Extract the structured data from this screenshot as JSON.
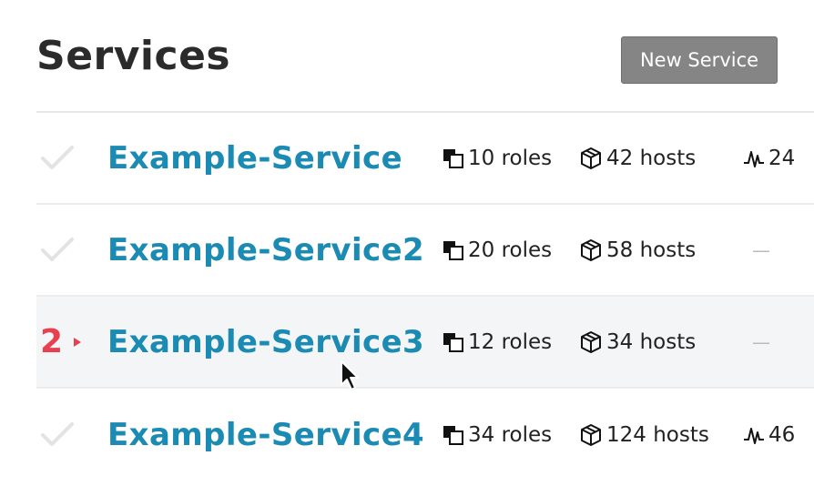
{
  "header": {
    "title": "Services",
    "new_button": "New Service"
  },
  "services": [
    {
      "name": "Example-Service",
      "roles": "10 roles",
      "hosts": "42 hosts",
      "metric": "24",
      "status": "check"
    },
    {
      "name": "Example-Service2",
      "roles": "20 roles",
      "hosts": "58 hosts",
      "metric": "",
      "status": "check"
    },
    {
      "name": "Example-Service3",
      "roles": "12 roles",
      "hosts": "34 hosts",
      "metric": "",
      "status": "alert",
      "alert_count": "2"
    },
    {
      "name": "Example-Service4",
      "roles": "34 roles",
      "hosts": "124 hosts",
      "metric": "46",
      "status": "check"
    }
  ],
  "icons": {
    "roles": "roles-icon",
    "hosts": "cube-icon",
    "metric": "pulse-icon",
    "status_ok": "check-icon",
    "status_alert": "caret-right-icon"
  },
  "colors": {
    "link": "#1b8bb4",
    "alert": "#e8404e",
    "button": "#858585",
    "row_highlight": "#f4f5f6"
  }
}
